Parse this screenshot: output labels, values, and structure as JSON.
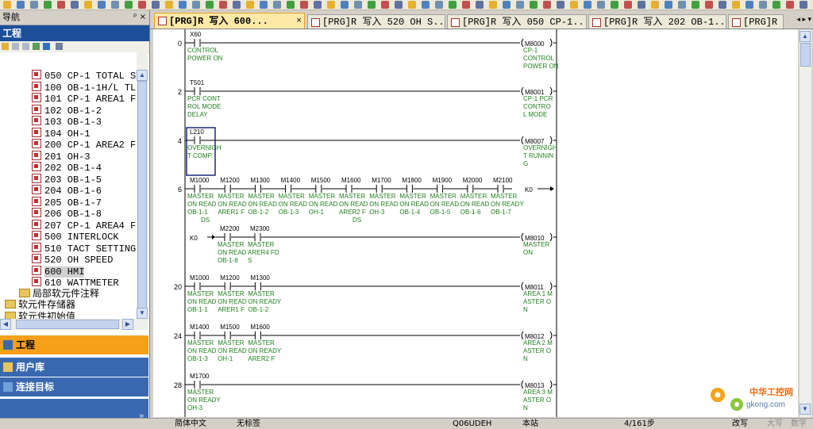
{
  "navigator": {
    "title": "导航",
    "pin": "ᵖ",
    "close": "×",
    "project_header": "工程",
    "tree": [
      {
        "label": "050 CP-1 TOTAL STA",
        "type": "program"
      },
      {
        "label": "100 OB-1-1H/L TL-1",
        "type": "program"
      },
      {
        "label": "101 CP-1 AREA1 FDS",
        "type": "program"
      },
      {
        "label": "102 OB-1-2",
        "type": "program"
      },
      {
        "label": "103 OB-1-3",
        "type": "program"
      },
      {
        "label": "104 OH-1",
        "type": "program"
      },
      {
        "label": "200 CP-1 AREA2 FDS",
        "type": "program"
      },
      {
        "label": "201 OH-3",
        "type": "program"
      },
      {
        "label": "202 OB-1-4",
        "type": "program"
      },
      {
        "label": "203 OB-1-5",
        "type": "program"
      },
      {
        "label": "204 OB-1-6",
        "type": "program"
      },
      {
        "label": "205 OB-1-7",
        "type": "program"
      },
      {
        "label": "206 OB-1-8",
        "type": "program"
      },
      {
        "label": "207 CP-1 AREA4 FDS",
        "type": "program"
      },
      {
        "label": "500 INTERLOCK",
        "type": "program"
      },
      {
        "label": "510 TACT SETTING",
        "type": "program"
      },
      {
        "label": "520 OH SPEED",
        "type": "program"
      },
      {
        "label": "600 HMI",
        "type": "program",
        "selected": true
      },
      {
        "label": "610 WATTMETER",
        "type": "program"
      },
      {
        "label": "局部软元件注释",
        "type": "folder"
      },
      {
        "label": "软元件存储器",
        "type": "folder-root"
      },
      {
        "label": "软元件初始值",
        "type": "folder-root"
      }
    ],
    "buttons": {
      "project": "工程",
      "library": "用户库",
      "connection": "连接目标",
      "more": "»"
    }
  },
  "tabs": [
    {
      "label": "[PRG]R 写入 600...",
      "active": true
    },
    {
      "label": "[PRG]R 写入 520 OH S...",
      "active": false
    },
    {
      "label": "[PRG]R 写入 050 CP-1...",
      "active": false
    },
    {
      "label": "[PRG]R 写入 202 OB-1...",
      "active": false
    },
    {
      "label": "[PRG]R",
      "active": false
    }
  ],
  "tab_close": "×",
  "tab_nav": "◂ ▸ ▾",
  "ladder": {
    "rungs": [
      {
        "step": "0",
        "contacts": [
          {
            "dev": "X60",
            "cmt": [
              "CONTROL",
              "POWER ON"
            ]
          }
        ],
        "coil": {
          "dev": "M8000",
          "cmt": [
            "CP-1",
            "CONTROL",
            "POWER ON"
          ]
        }
      },
      {
        "step": "2",
        "contacts": [
          {
            "dev": "T501",
            "cmt": [
              "PCR CONT",
              "ROL MODE",
              " DELAY"
            ]
          }
        ],
        "coil": {
          "dev": "M8001",
          "cmt": [
            "CP-1 PCR",
            " CONTRO",
            "L MODE"
          ]
        }
      },
      {
        "step": "4",
        "contacts": [
          {
            "dev": "L210",
            "cmt": [
              "OVERNIGH",
              "T COMP."
            ]
          }
        ],
        "coil": {
          "dev": "M8007",
          "cmt": [
            "OVERNIGH",
            "T RUNNIN",
            "G"
          ]
        }
      },
      {
        "step": "6",
        "contacts": [
          {
            "dev": "M1000",
            "cmt": [
              "MASTER",
              "ON READ",
              "OB-1-1"
            ]
          },
          {
            "dev": "M1200",
            "cmt": [
              "MASTER",
              "ON READ",
              "ARER1 F"
            ]
          },
          {
            "dev": "M1300",
            "cmt": [
              "MASTER",
              "ON READ",
              "OB-1-2"
            ]
          },
          {
            "dev": "M1400",
            "cmt": [
              "MASTER",
              "ON READ",
              "OB-1-3"
            ]
          },
          {
            "dev": "M1500",
            "cmt": [
              "MASTER",
              "ON READ",
              "OH-1"
            ]
          },
          {
            "dev": "M1600",
            "cmt": [
              "MASTER",
              "ON READ",
              "ARER2 F"
            ]
          },
          {
            "dev": "M1700",
            "cmt": [
              "MASTER",
              "ON READ",
              "OH-3"
            ]
          },
          {
            "dev": "M1800",
            "cmt": [
              "MASTER",
              "ON READ",
              "OB-1-4"
            ]
          },
          {
            "dev": "M1900",
            "cmt": [
              "MASTER",
              "ON READ",
              "OB-1-5"
            ]
          },
          {
            "dev": "M2000",
            "cmt": [
              "MASTER",
              "ON READ",
              "OB-1-6"
            ]
          },
          {
            "dev": "M2100",
            "cmt": [
              "MASTER",
              "ON READY",
              "OB-1-7"
            ]
          }
        ],
        "extra": [
          "DS",
          "",
          "",
          "",
          "",
          "DS"
        ],
        "coil": {
          "dev": "K0",
          "cmt": []
        }
      },
      {
        "step": "",
        "contacts": [
          {
            "dev": "M2200",
            "cmt": [
              "MASTER",
              "ON READ",
              "OB-1-8"
            ]
          },
          {
            "dev": "M2300",
            "cmt": [
              "MASTER",
              "ARER4 FD",
              "S"
            ]
          }
        ],
        "prefix": "K0",
        "coil": {
          "dev": "M8010",
          "cmt": [
            "MASTER",
            "ON"
          ]
        }
      },
      {
        "step": "20",
        "contacts": [
          {
            "dev": "M1000",
            "cmt": [
              "MASTER",
              "ON READ",
              "OB-1-1"
            ]
          },
          {
            "dev": "M1200",
            "cmt": [
              "MASTER",
              "ON READ",
              "ARER1 F"
            ]
          },
          {
            "dev": "M1300",
            "cmt": [
              "MASTER",
              "ON READY",
              "OB-1-2"
            ]
          }
        ],
        "coil": {
          "dev": "M8011",
          "cmt": [
            "AREA 1 M",
            "ASTER O",
            "N"
          ]
        }
      },
      {
        "step": "24",
        "contacts": [
          {
            "dev": "M1400",
            "cmt": [
              "MASTER",
              "ON READ",
              "OB-1-3"
            ]
          },
          {
            "dev": "M1500",
            "cmt": [
              "MASTER",
              "ON READ",
              "OH-1"
            ]
          },
          {
            "dev": "M1600",
            "cmt": [
              "MASTER",
              "ON READY",
              "ARER2 F"
            ]
          }
        ],
        "coil": {
          "dev": "M8012",
          "cmt": [
            "AREA 2 M",
            "ASTER O",
            "N"
          ]
        }
      },
      {
        "step": "28",
        "contacts": [
          {
            "dev": "M1700",
            "cmt": [
              "MASTER",
              "ON READY",
              "OH-3"
            ]
          }
        ],
        "coil": {
          "dev": "M8013",
          "cmt": [
            "AREA 3 M",
            "ASTER O",
            "N"
          ]
        }
      }
    ]
  },
  "statusbar": {
    "lang": "简体中文",
    "label": "无标签",
    "cpu": "Q06UDEH",
    "station": "本站",
    "steps": "4/161步",
    "mode": "改写",
    "caps": "大写",
    "num": "数字"
  },
  "watermark": {
    "text": "中华工控网",
    "url": "gkong.com"
  },
  "colors": {
    "comment": "#208020",
    "nav_blue": "#3a68b0",
    "nav_active": "#f6a01a",
    "tab_active": "#ffe9a8",
    "cursor": "#1a2a80"
  }
}
